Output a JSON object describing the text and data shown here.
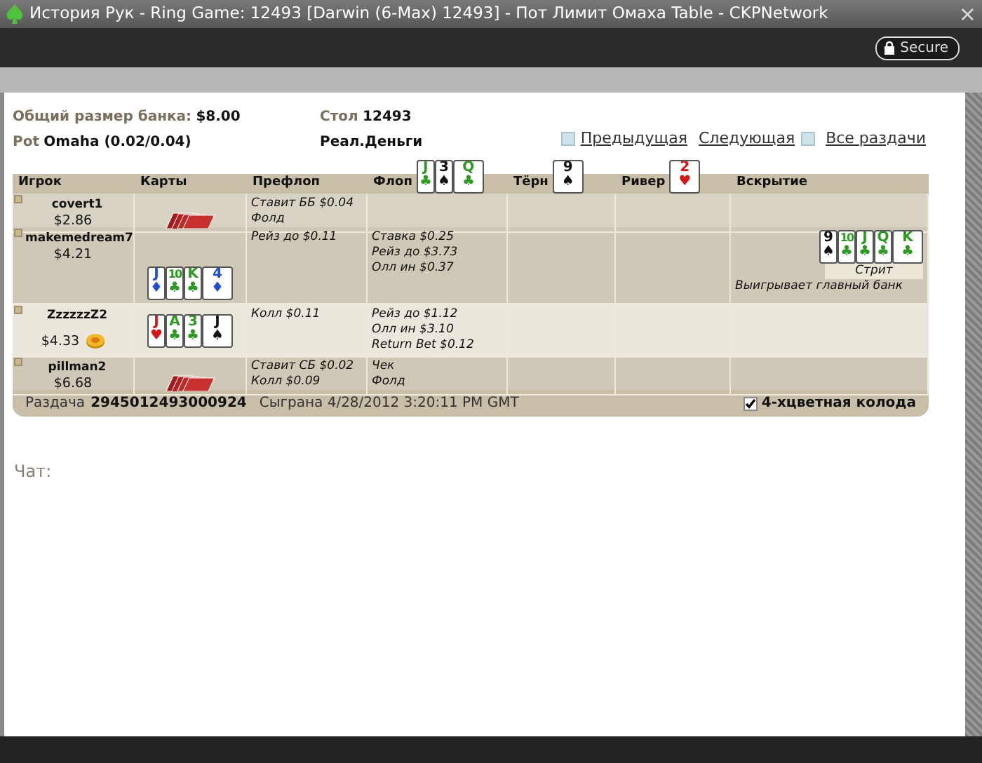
{
  "window": {
    "title": "История Рук - Ring Game: 12493 [Darwin (6-Max) 12493] - Пот Лимит Омаха Table - CKPNetwork",
    "close": "×"
  },
  "secure_button": "Secure",
  "info": {
    "pot_label": "Общий размер банка:",
    "pot_value": "$8.00",
    "game_label": "Pot",
    "game_value": "Omaha (0.02/0.04)",
    "table_label": "Стол",
    "table_value": "12493",
    "money_type": "Реал.Деньги"
  },
  "nav": [
    {
      "label": "Предыдущая",
      "kind": "prev"
    },
    {
      "label": "Следующая",
      "kind": "next"
    },
    {
      "label": "Все раздачи",
      "kind": "plain"
    }
  ],
  "table": {
    "columns": [
      {
        "label": "Игрок"
      },
      {
        "label": "Карты"
      },
      {
        "label": "Префлоп"
      },
      {
        "label": "Флоп",
        "cards": [
          {
            "rank": "J",
            "suit": "♣",
            "color": "#2f9a23"
          },
          {
            "rank": "3",
            "suit": "♠",
            "color": "#111111"
          },
          {
            "rank": "Q",
            "suit": "♣",
            "color": "#2f9a23"
          }
        ]
      },
      {
        "label": "Тёрн",
        "cards": [
          {
            "rank": "9",
            "suit": "♠",
            "color": "#111111"
          }
        ]
      },
      {
        "label": "Ривер",
        "cards": [
          {
            "rank": "2",
            "suit": "♥",
            "color": "#d01818"
          }
        ]
      },
      {
        "label": "Вскрытие"
      }
    ],
    "rows": [
      {
        "name": "covert1",
        "stack": "$2.86",
        "dealer": false,
        "hole": {
          "kind": "back"
        },
        "preflop": [
          "Ставит ББ $0.04",
          "Фолд"
        ],
        "flop": []
      },
      {
        "name": "makemedream7",
        "stack": "$4.21",
        "dealer": false,
        "hole": {
          "kind": "cards",
          "cards": [
            {
              "rank": "J",
              "suit": "♦",
              "color": "#1f4fd0"
            },
            {
              "rank": "10",
              "suit": "♣",
              "color": "#2f9a23"
            },
            {
              "rank": "K",
              "suit": "♣",
              "color": "#2f9a23"
            },
            {
              "rank": "4",
              "suit": "♦",
              "color": "#1f4fd0"
            }
          ]
        },
        "preflop": [
          "Рейз до $0.11"
        ],
        "flop": [
          "Ставка $0.25",
          "Рейз до $3.73",
          "Олл ин $0.37"
        ],
        "showdown": {
          "cards": [
            {
              "rank": "9",
              "suit": "♠",
              "color": "#111111"
            },
            {
              "rank": "10",
              "suit": "♣",
              "color": "#2f9a23"
            },
            {
              "rank": "J",
              "suit": "♣",
              "color": "#2f9a23"
            },
            {
              "rank": "Q",
              "suit": "♣",
              "color": "#2f9a23"
            },
            {
              "rank": "K",
              "suit": "♣",
              "color": "#2f9a23"
            }
          ],
          "hand": "Стрит",
          "result": "Выигрывает главный банк"
        }
      },
      {
        "name": "ZzzzzzZ2",
        "stack": "$4.33",
        "dealer": true,
        "hole": {
          "kind": "cards",
          "cards": [
            {
              "rank": "J",
              "suit": "♥",
              "color": "#d01818"
            },
            {
              "rank": "A",
              "suit": "♣",
              "color": "#2f9a23"
            },
            {
              "rank": "3",
              "suit": "♣",
              "color": "#2f9a23"
            },
            {
              "rank": "J",
              "suit": "♠",
              "color": "#111111"
            }
          ]
        },
        "preflop": [
          "Колл $0.11"
        ],
        "flop": [
          "Рейз до $1.12",
          "Олл ин $3.10",
          "Return Bet $0.12"
        ]
      },
      {
        "name": "pillman2",
        "stack": "$6.68",
        "dealer": false,
        "hole": {
          "kind": "back"
        },
        "preflop": [
          "Ставит СБ $0.02",
          "Колл $0.09"
        ],
        "flop": [
          "Чек",
          "Фолд"
        ]
      }
    ]
  },
  "footer": {
    "hand_label": "Раздача",
    "hand_number": "2945012493000924",
    "played": "Сыграна 4/28/2012 3:20:11 PM GMT",
    "deck_option": {
      "label": "4-хцветная колода",
      "checked": true
    }
  },
  "chat_label": "Чат:"
}
